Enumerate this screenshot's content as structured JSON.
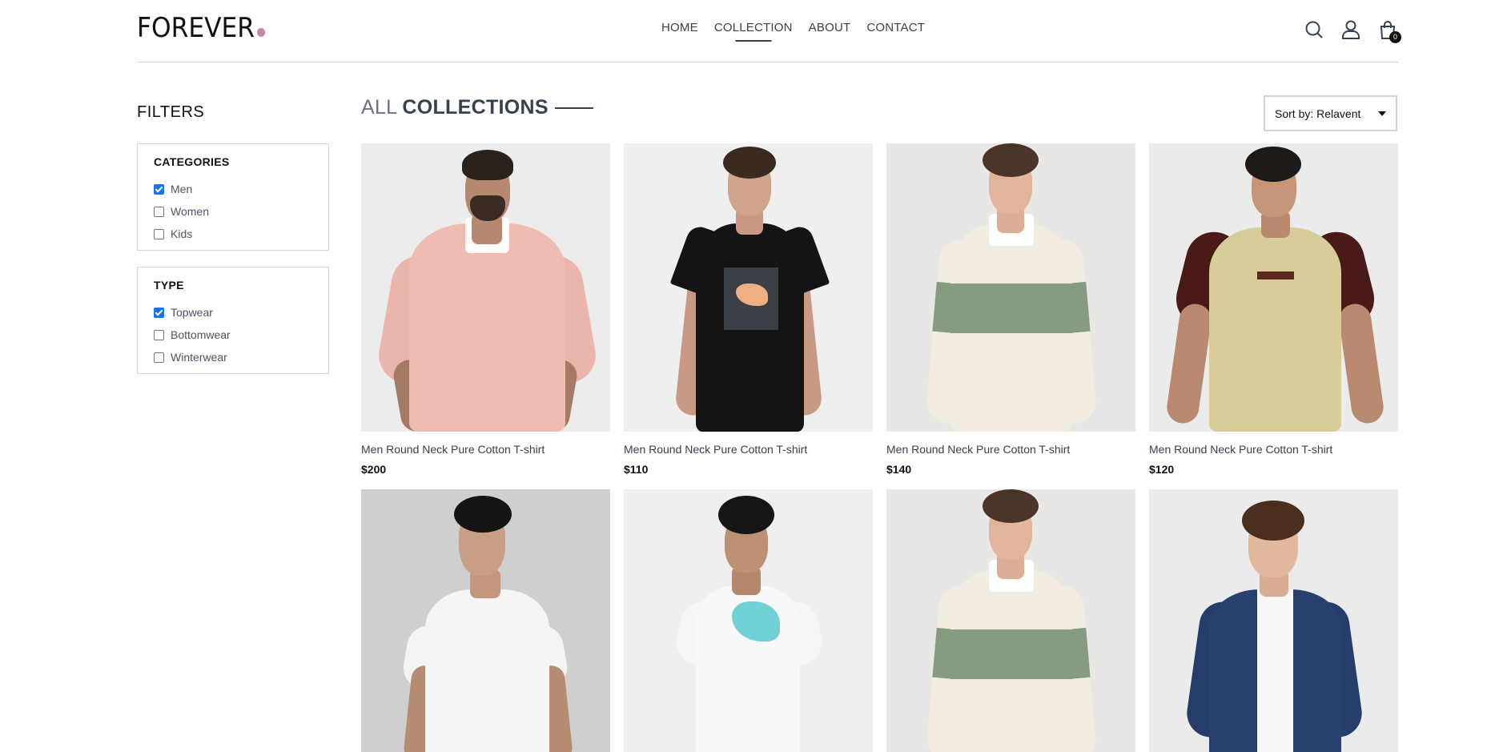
{
  "header": {
    "logo_text": "FOREVER",
    "nav": [
      "HOME",
      "COLLECTION",
      "ABOUT",
      "CONTACT"
    ],
    "active_nav": "COLLECTION",
    "cart_count": "0",
    "icons": [
      "search-icon",
      "profile-icon",
      "cart-icon"
    ]
  },
  "filters": {
    "title": "FILTERS",
    "categories": {
      "heading": "CATEGORIES",
      "options": [
        {
          "label": "Men",
          "checked": true
        },
        {
          "label": "Women",
          "checked": false
        },
        {
          "label": "Kids",
          "checked": false
        }
      ]
    },
    "type": {
      "heading": "TYPE",
      "options": [
        {
          "label": "Topwear",
          "checked": true
        },
        {
          "label": "Bottomwear",
          "checked": false
        },
        {
          "label": "Winterwear",
          "checked": false
        }
      ]
    }
  },
  "main": {
    "title_light": "ALL",
    "title_dark": "COLLECTIONS",
    "sort_value": "Sort by: Relavent",
    "products": [
      {
        "name": "Men Round Neck Pure Cotton T-shirt",
        "price": "$200"
      },
      {
        "name": "Men Round Neck Pure Cotton T-shirt",
        "price": "$110"
      },
      {
        "name": "Men Round Neck Pure Cotton T-shirt",
        "price": "$140"
      },
      {
        "name": "Men Round Neck Pure Cotton T-shirt",
        "price": "$120"
      },
      {
        "name": "",
        "price": ""
      },
      {
        "name": "",
        "price": ""
      },
      {
        "name": "",
        "price": ""
      },
      {
        "name": "",
        "price": ""
      }
    ]
  },
  "colors": {
    "accent_dot": "#c586a5",
    "checkbox_checked": "#1a73e8",
    "text_dark": "#374151"
  }
}
